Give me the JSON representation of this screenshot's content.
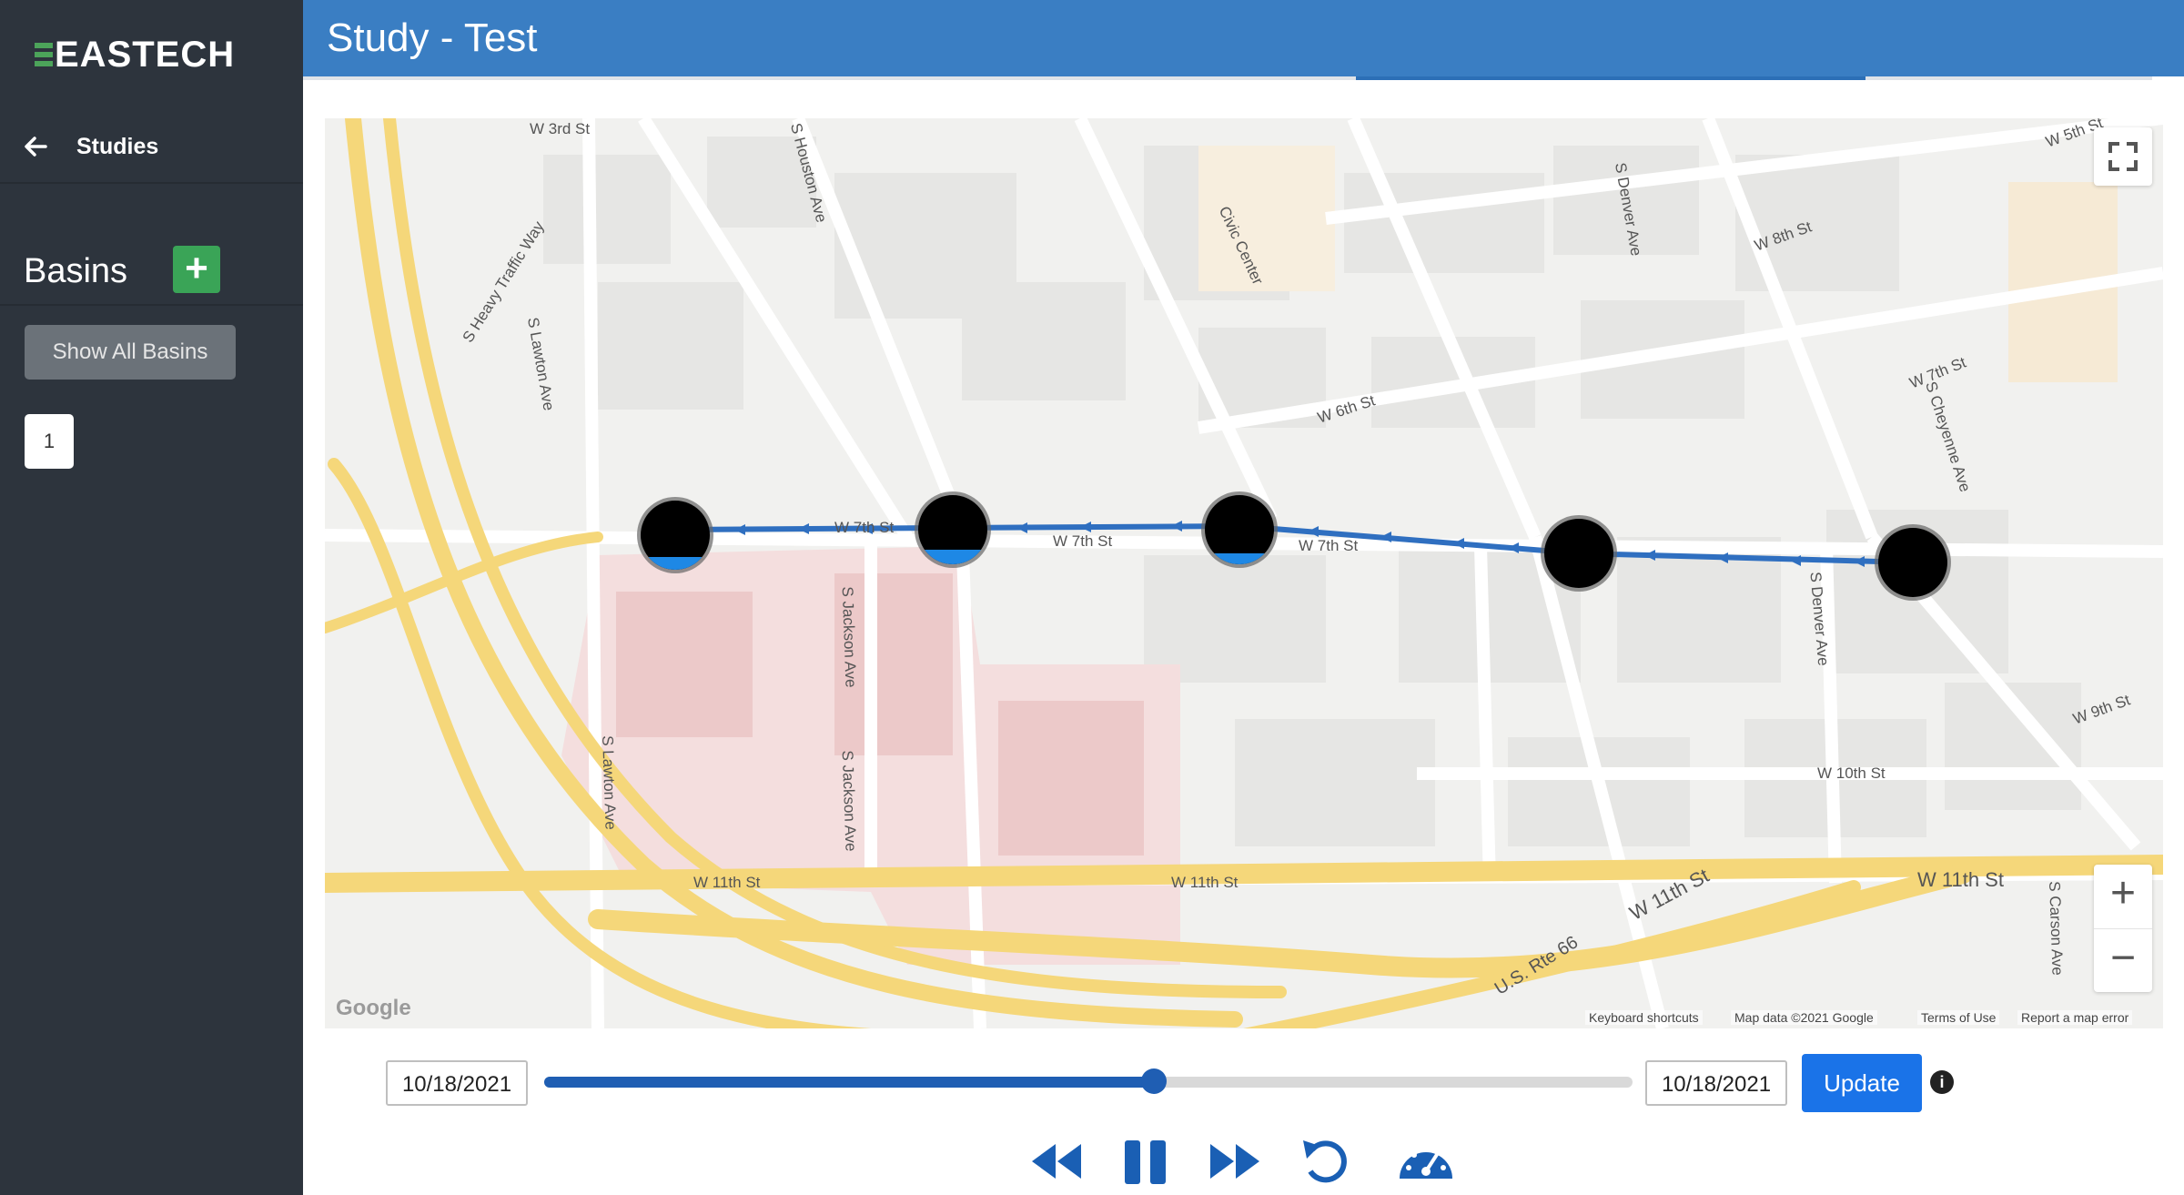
{
  "sidebar": {
    "logo_text": "EASTECH",
    "back_label": "Studies",
    "section_title": "Basins",
    "add_label": "+",
    "show_all_label": "Show All Basins",
    "basins": [
      "1"
    ]
  },
  "header": {
    "title": "Study - Test"
  },
  "map": {
    "fullscreen_icon": "fullscreen-icon",
    "zoom_in": "+",
    "zoom_out": "−",
    "watermark": "Google",
    "street_labels": {
      "w3rd": "W 3rd St",
      "w5th": "W 5th St",
      "w6th": "W 6th St",
      "w7th_a": "W 7th St",
      "w7th_b": "W 7th St",
      "w7th_c": "W 7th St",
      "w7th_ne": "W 7th St",
      "w8th": "W 8th St",
      "w9th": "W 9th St",
      "w10th": "W 10th St",
      "w11th_a": "W 11th St",
      "w11th_b": "W 11th St",
      "w11th_c": "W 11th St",
      "w11th_d": "W 11th St",
      "usrte": "U.S. Rte 66",
      "heavy": "S Heavy Traffic Way",
      "lawton": "S Lawton Ave",
      "houston": "S Houston Ave",
      "denver": "S Denver Ave",
      "denver2": "S Denver Ave",
      "cheyenne": "S Cheyenne Ave",
      "civic": "Civic Center",
      "jackson": "S Jackson Ave",
      "lawton2": "S Lawton Ave",
      "jackson2": "S Jackson Ave",
      "carson": "S Carson Ave"
    },
    "attribution": {
      "shortcuts": "Keyboard shortcuts",
      "mapdata": "Map data ©2021 Google",
      "terms": "Terms of Use",
      "report": "Report a map error"
    },
    "route_color": "#2f6fc0",
    "node_color": "#000000",
    "fill_color": "#1e88e5"
  },
  "timeline": {
    "start_date": "10/18/2021",
    "end_date": "10/18/2021",
    "update_label": "Update",
    "progress": 0.56,
    "info_icon": "info-icon",
    "accent": "#1f5eb3"
  },
  "controls": [
    "rewind-icon",
    "pause-icon",
    "fast-forward-icon",
    "replay-icon",
    "speed-icon"
  ]
}
